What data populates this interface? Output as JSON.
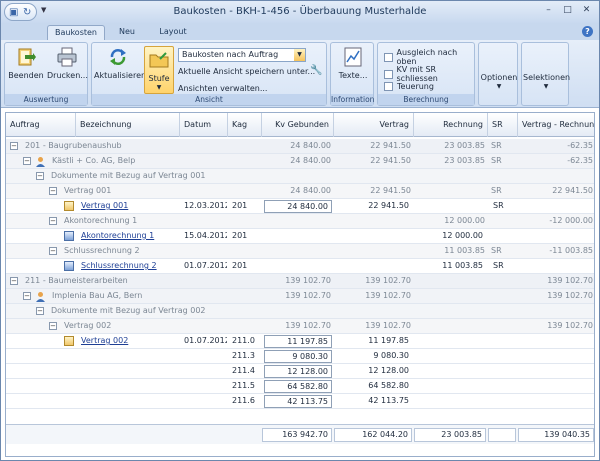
{
  "window": {
    "title": "Baukosten - BKH-1-456 - Überbauung Musterhalde"
  },
  "tabs": [
    {
      "label": "Baukosten"
    },
    {
      "label": "Neu"
    },
    {
      "label": "Layout"
    }
  ],
  "ribbon": {
    "auswertung": {
      "label": "Auswertung",
      "beenden": "Beenden",
      "drucken": "Drucken..."
    },
    "ansicht": {
      "label": "Ansicht",
      "aktualisieren": "Aktualisieren",
      "stufe": "Stufe",
      "combo_value": "Baukosten nach Auftrag",
      "save_view": "Aktuelle Ansicht speichern unter...",
      "manage_views": "Ansichten verwalten..."
    },
    "information": {
      "label": "Information",
      "texte": "Texte..."
    },
    "berechnung": {
      "label": "Berechnung",
      "checks": [
        "Ausgleich nach oben",
        "KV mit SR schliessen",
        "Teuerung"
      ]
    },
    "optionen": "Optionen",
    "selektionen": "Selektionen"
  },
  "table": {
    "columns": [
      "Auftrag",
      "Bezeichnung",
      "Datum",
      "Kag",
      "Kv Gebunden",
      "Vertrag",
      "Rechnung",
      "SR",
      "Vertrag - Rechnung"
    ],
    "rows": [
      {
        "level": 0,
        "kind": "group",
        "label": "201 - Baugrubenaushub",
        "kv": "24 840.00",
        "vertrag": "22 941.50",
        "rechnung": "23 003.85",
        "sr": "SR",
        "diff": "-62.35"
      },
      {
        "level": 1,
        "kind": "group",
        "label": "Kästli  + Co. AG, Belp",
        "icon": "person",
        "kv": "24 840.00",
        "vertrag": "22 941.50",
        "rechnung": "23 003.85",
        "sr": "SR",
        "diff": "-62.35"
      },
      {
        "level": 2,
        "kind": "group",
        "label": "Dokumente mit Bezug auf Vertrag 001",
        "kv": "",
        "vertrag": "",
        "rechnung": "",
        "sr": "",
        "diff": ""
      },
      {
        "level": 3,
        "kind": "group",
        "label": "Vertrag 001",
        "kv": "24 840.00",
        "vertrag": "22 941.50",
        "rechnung": "",
        "sr": "SR",
        "diff": "22 941.50"
      },
      {
        "level": 4,
        "kind": "data",
        "icon": "doc",
        "bez": "Vertrag 001",
        "datum": "12.03.2012",
        "kag": "201",
        "kv": "24 840.00",
        "vertrag": "22 941.50",
        "rechnung": "",
        "sr": "SR",
        "diff": ""
      },
      {
        "level": 3,
        "kind": "group",
        "label": "Akontorechnung 1",
        "kv": "",
        "vertrag": "",
        "rechnung": "12 000.00",
        "sr": "",
        "diff": "-12 000.00"
      },
      {
        "level": 4,
        "kind": "data",
        "icon": "docblue",
        "bez": "Akontorechnung 1",
        "datum": "15.04.2012",
        "kag": "201",
        "kv": "",
        "vertrag": "",
        "rechnung": "12 000.00",
        "sr": "",
        "diff": ""
      },
      {
        "level": 3,
        "kind": "group",
        "label": "Schlussrechnung 2",
        "kv": "",
        "vertrag": "",
        "rechnung": "11 003.85",
        "sr": "SR",
        "diff": "-11 003.85"
      },
      {
        "level": 4,
        "kind": "data",
        "icon": "docblue",
        "bez": "Schlussrechnung 2",
        "datum": "01.07.2012",
        "kag": "201",
        "kv": "",
        "vertrag": "",
        "rechnung": "11 003.85",
        "sr": "SR",
        "diff": ""
      },
      {
        "level": 0,
        "kind": "group",
        "label": "211 - Baumeisterarbeiten",
        "kv": "139 102.70",
        "vertrag": "139 102.70",
        "rechnung": "",
        "sr": "",
        "diff": "139 102.70"
      },
      {
        "level": 1,
        "kind": "group",
        "label": "Implenia Bau AG, Bern",
        "icon": "person",
        "kv": "139 102.70",
        "vertrag": "139 102.70",
        "rechnung": "",
        "sr": "",
        "diff": "139 102.70"
      },
      {
        "level": 2,
        "kind": "group",
        "label": "Dokumente mit Bezug auf Vertrag 002",
        "kv": "",
        "vertrag": "",
        "rechnung": "",
        "sr": "",
        "diff": ""
      },
      {
        "level": 3,
        "kind": "group",
        "label": "Vertrag 002",
        "kv": "139 102.70",
        "vertrag": "139 102.70",
        "rechnung": "",
        "sr": "",
        "diff": "139 102.70"
      },
      {
        "level": 4,
        "kind": "data",
        "icon": "doc",
        "bez": "Vertrag 002",
        "datum": "01.07.2012",
        "kag": "211.0",
        "kv": "11 197.85",
        "vertrag": "11 197.85",
        "rechnung": "",
        "sr": "",
        "diff": ""
      },
      {
        "level": 4,
        "kind": "data",
        "bez": "",
        "datum": "",
        "kag": "211.3",
        "kv": "9 080.30",
        "vertrag": "9 080.30",
        "rechnung": "",
        "sr": "",
        "diff": ""
      },
      {
        "level": 4,
        "kind": "data",
        "bez": "",
        "datum": "",
        "kag": "211.4",
        "kv": "12 128.00",
        "vertrag": "12 128.00",
        "rechnung": "",
        "sr": "",
        "diff": ""
      },
      {
        "level": 4,
        "kind": "data",
        "bez": "",
        "datum": "",
        "kag": "211.5",
        "kv": "64 582.80",
        "vertrag": "64 582.80",
        "rechnung": "",
        "sr": "",
        "diff": ""
      },
      {
        "level": 4,
        "kind": "data",
        "bez": "",
        "datum": "",
        "kag": "211.6",
        "kv": "42 113.75",
        "vertrag": "42 113.75",
        "rechnung": "",
        "sr": "",
        "diff": ""
      }
    ],
    "totals": {
      "kv": "163 942.70",
      "vertrag": "162 044.20",
      "rechnung": "23 003.85",
      "diff": "139 040.35"
    }
  }
}
